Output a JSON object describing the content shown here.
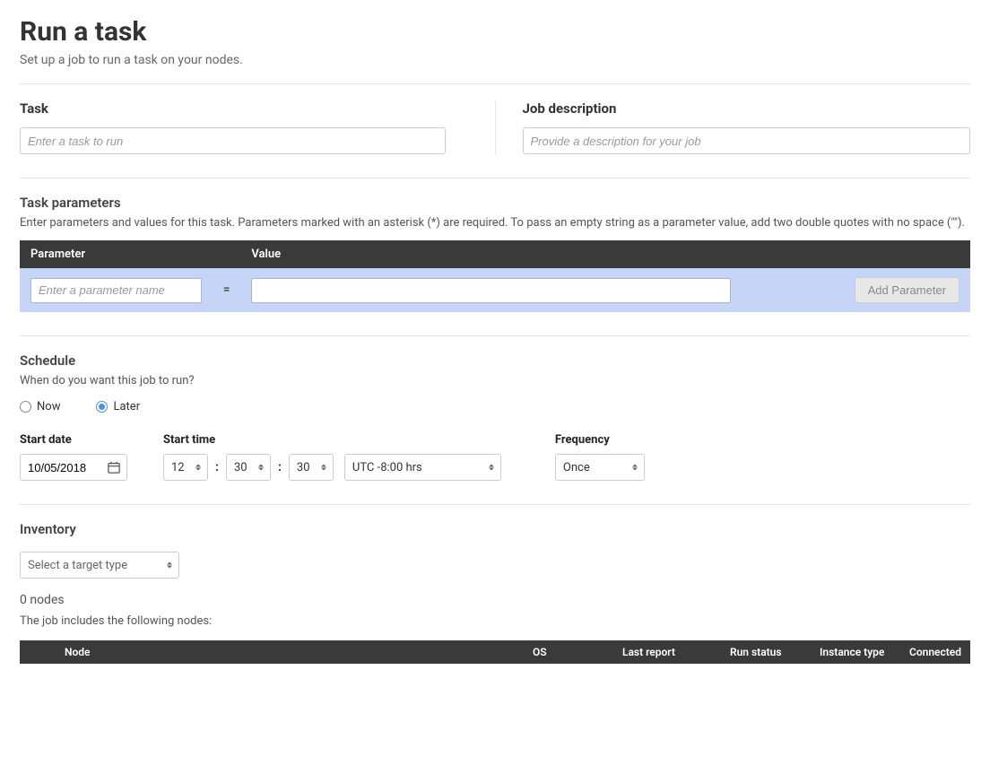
{
  "header": {
    "title": "Run a task",
    "subtitle": "Set up a job to run a task on your nodes."
  },
  "task": {
    "label": "Task",
    "placeholder": "Enter a task to run"
  },
  "job_description": {
    "label": "Job description",
    "placeholder": "Provide a description for your job"
  },
  "task_parameters": {
    "heading": "Task parameters",
    "help": "Enter parameters and values for this task. Parameters marked with an asterisk (*) are required. To pass an empty string as a parameter value, add two double quotes with no space (\"\").",
    "columns": {
      "parameter": "Parameter",
      "value": "Value"
    },
    "name_placeholder": "Enter a parameter name",
    "eq": "=",
    "add_button": "Add Parameter"
  },
  "schedule": {
    "heading": "Schedule",
    "question": "When do you want this job to run?",
    "options": {
      "now": "Now",
      "later": "Later"
    },
    "selected": "later",
    "start_date_label": "Start date",
    "start_date_value": "10/05/2018",
    "start_time_label": "Start time",
    "hour": "12",
    "minute": "30",
    "second": "30",
    "timezone": "UTC -8:00 hrs",
    "frequency_label": "Frequency",
    "frequency_value": "Once"
  },
  "inventory": {
    "heading": "Inventory",
    "select_placeholder": "Select a target type",
    "nodes_count": "0 nodes",
    "nodes_help": "The job includes the following nodes:",
    "columns": {
      "node": "Node",
      "os": "OS",
      "last_report": "Last report",
      "run_status": "Run status",
      "instance_type": "Instance type",
      "connected": "Connected"
    }
  }
}
